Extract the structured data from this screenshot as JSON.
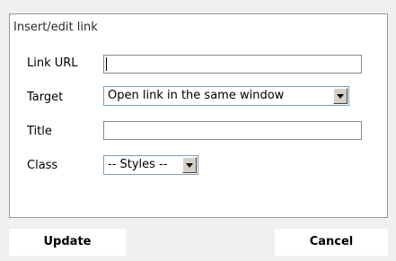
{
  "dialog": {
    "legend": "Insert/edit link"
  },
  "fields": {
    "link_url": {
      "label": "Link URL",
      "value": "",
      "placeholder": ""
    },
    "target": {
      "label": "Target",
      "selected": "Open link in the same window"
    },
    "title": {
      "label": "Title",
      "value": "",
      "placeholder": ""
    },
    "class": {
      "label": "Class",
      "selected": "-- Styles --"
    }
  },
  "buttons": {
    "update": "Update",
    "cancel": "Cancel"
  },
  "icons": {
    "dropdown": "chevron-down-icon"
  }
}
